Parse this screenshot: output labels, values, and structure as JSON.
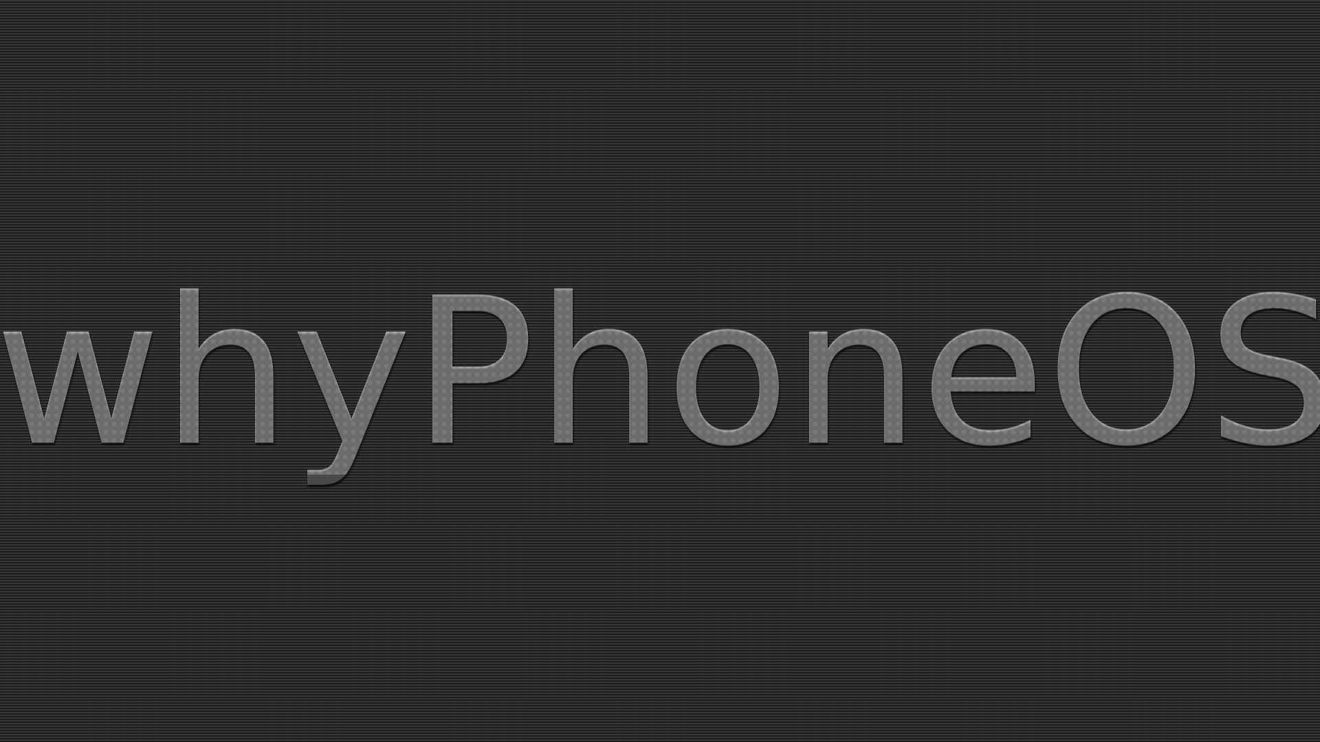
{
  "wallpaper": {
    "logo_text": "whyPhoneOS"
  }
}
